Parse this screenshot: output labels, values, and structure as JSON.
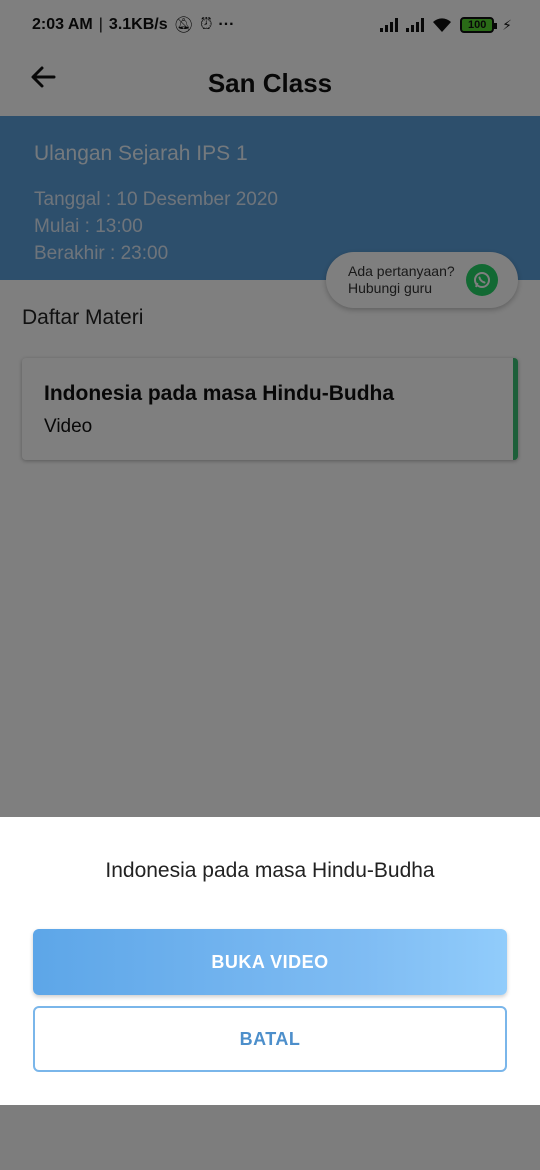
{
  "status_bar": {
    "time": "2:03 AM",
    "network_speed": "3.1KB/s",
    "battery": "100",
    "icons": [
      "mute-icon",
      "alarm-icon",
      "more-icon",
      "signal-icon",
      "signal-icon",
      "wifi-icon",
      "battery-icon",
      "charging-icon"
    ]
  },
  "app_bar": {
    "title": "San Class",
    "back_icon": "arrow-left-icon"
  },
  "exam": {
    "title": "Ulangan Sejarah IPS 1",
    "date": "Tanggal : 10 Desember 2020",
    "start": "Mulai : 13:00",
    "end": "Berakhir : 23:00"
  },
  "help": {
    "line1": "Ada pertanyaan?",
    "line2": "Hubungi guru",
    "icon": "whatsapp-icon"
  },
  "materials": {
    "section_title": "Daftar Materi",
    "items": [
      {
        "title": "Indonesia pada masa Hindu-Budha",
        "type": "Video"
      }
    ]
  },
  "dialog": {
    "title": "Indonesia pada masa Hindu-Budha",
    "primary_label": "BUKA VIDEO",
    "cancel_label": "BATAL"
  },
  "colors": {
    "header_blue": "#5b9fd9",
    "accent_green": "#3bbf74",
    "button_blue": "#5da6e8"
  }
}
